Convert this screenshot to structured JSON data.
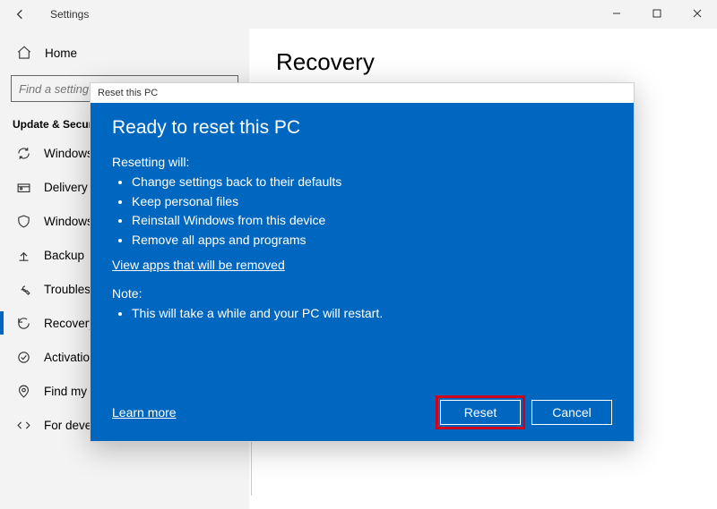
{
  "window": {
    "title": "Settings"
  },
  "sidebar": {
    "home": "Home",
    "search_placeholder": "Find a setting",
    "category": "Update & Security",
    "items": [
      {
        "label": "Windows Update",
        "icon": "sync"
      },
      {
        "label": "Delivery Optimization",
        "icon": "delivery"
      },
      {
        "label": "Windows Security",
        "icon": "shield"
      },
      {
        "label": "Backup",
        "icon": "backup"
      },
      {
        "label": "Troubleshoot",
        "icon": "troubleshoot"
      },
      {
        "label": "Recovery",
        "icon": "recovery",
        "active": true
      },
      {
        "label": "Activation",
        "icon": "activation"
      },
      {
        "label": "Find my device",
        "icon": "find"
      },
      {
        "label": "For developers",
        "icon": "developers"
      }
    ]
  },
  "content": {
    "page_title": "Recovery"
  },
  "dialog": {
    "title": "Reset this PC",
    "heading": "Ready to reset this PC",
    "resetting_label": "Resetting will:",
    "reset_points": [
      "Change settings back to their defaults",
      "Keep personal files",
      "Reinstall Windows from this device",
      "Remove all apps and programs"
    ],
    "view_apps_link": "View apps that will be removed",
    "note_label": "Note:",
    "note_points": [
      "This will take a while and your PC will restart."
    ],
    "learn_more": "Learn more",
    "reset_btn": "Reset",
    "cancel_btn": "Cancel"
  }
}
